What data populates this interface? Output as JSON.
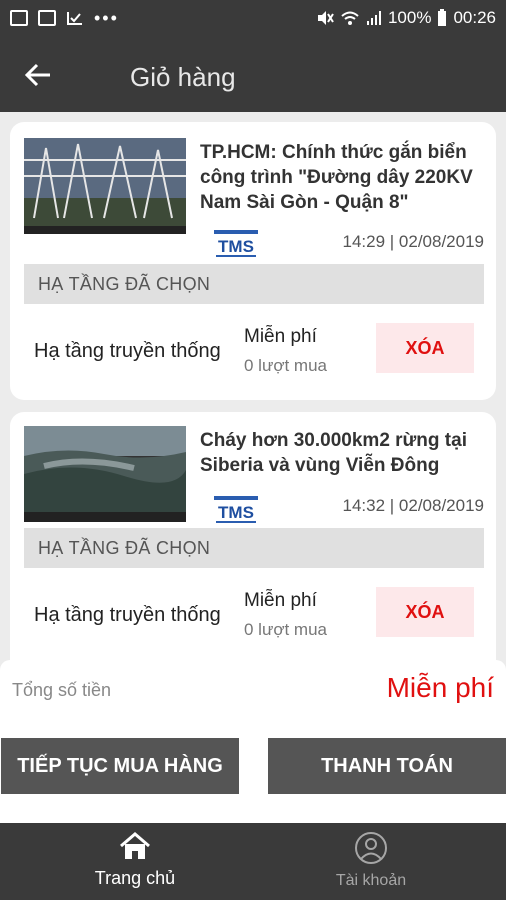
{
  "status": {
    "battery": "100%",
    "time": "00:26"
  },
  "header": {
    "title": "Giỏ hàng"
  },
  "cart": [
    {
      "headline_lines": [
        "TP.HCM: Chính thức gắn biển",
        "công trình \"Đường dây 220KV",
        "Nam Sài Gòn - Quận 8\""
      ],
      "source": "TMS",
      "datetime": "14:29 | 02/08/2019",
      "section": "HẠ TẦNG ĐÃ CHỌN",
      "infrastructure": "Hạ tầng truyền thống",
      "price": "Miễn phí",
      "purchases": "0 lượt mua",
      "delete_label": "XÓA"
    },
    {
      "headline_lines": [
        "Cháy hơn 30.000km2 rừng tại",
        "Siberia và vùng Viễn Đông"
      ],
      "source": "TMS",
      "datetime": "14:32 | 02/08/2019",
      "section": "HẠ TẦNG ĐÃ CHỌN",
      "infrastructure": "Hạ tầng truyền thống",
      "price": "Miễn phí",
      "purchases": "0 lượt mua",
      "delete_label": "XÓA"
    }
  ],
  "summary": {
    "total_label": "Tổng số tiền",
    "total_value": "Miễn phí"
  },
  "actions": {
    "continue_label": "TIẾP TỤC MUA HÀNG",
    "checkout_label": "THANH TOÁN"
  },
  "nav": {
    "home_label": "Trang chủ",
    "account_label": "Tài khoản"
  },
  "colors": {
    "bar": "#3a3a3a",
    "accent_red": "#e01010",
    "delete_bg": "#fde8ea"
  },
  "icons": [
    "back-arrow-icon",
    "home-icon",
    "account-icon"
  ]
}
